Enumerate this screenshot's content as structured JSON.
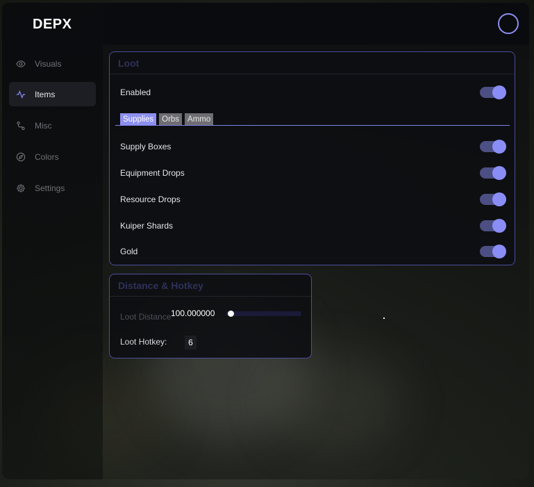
{
  "app": {
    "title": "DEPX"
  },
  "sidebar": {
    "items": [
      {
        "label": "Visuals",
        "icon": "eye-icon",
        "active": false
      },
      {
        "label": "Items",
        "icon": "activity-icon",
        "active": true
      },
      {
        "label": "Misc",
        "icon": "route-icon",
        "active": false
      },
      {
        "label": "Colors",
        "icon": "compass-icon",
        "active": false
      },
      {
        "label": "Settings",
        "icon": "gear-icon",
        "active": false
      }
    ]
  },
  "loot": {
    "title": "Loot",
    "enabled_label": "Enabled",
    "enabled": true,
    "tabs": [
      {
        "label": "Supplies",
        "active": true
      },
      {
        "label": "Orbs",
        "active": false
      },
      {
        "label": "Ammo",
        "active": false
      }
    ],
    "items": [
      {
        "label": "Supply Boxes",
        "on": true
      },
      {
        "label": "Equipment Drops",
        "on": true
      },
      {
        "label": "Resource Drops",
        "on": true
      },
      {
        "label": "Kuiper Shards",
        "on": true
      },
      {
        "label": "Gold",
        "on": true
      }
    ]
  },
  "distance": {
    "title": "Distance & Hotkey",
    "distance_label": "Loot Distance",
    "distance_value": "100.000000",
    "hotkey_label": "Loot Hotkey:",
    "hotkey_value": "6"
  },
  "colors": {
    "accent": "#8a8df5",
    "tab_active": "#8d8ff0",
    "panel_border": "#4b4f9a"
  }
}
